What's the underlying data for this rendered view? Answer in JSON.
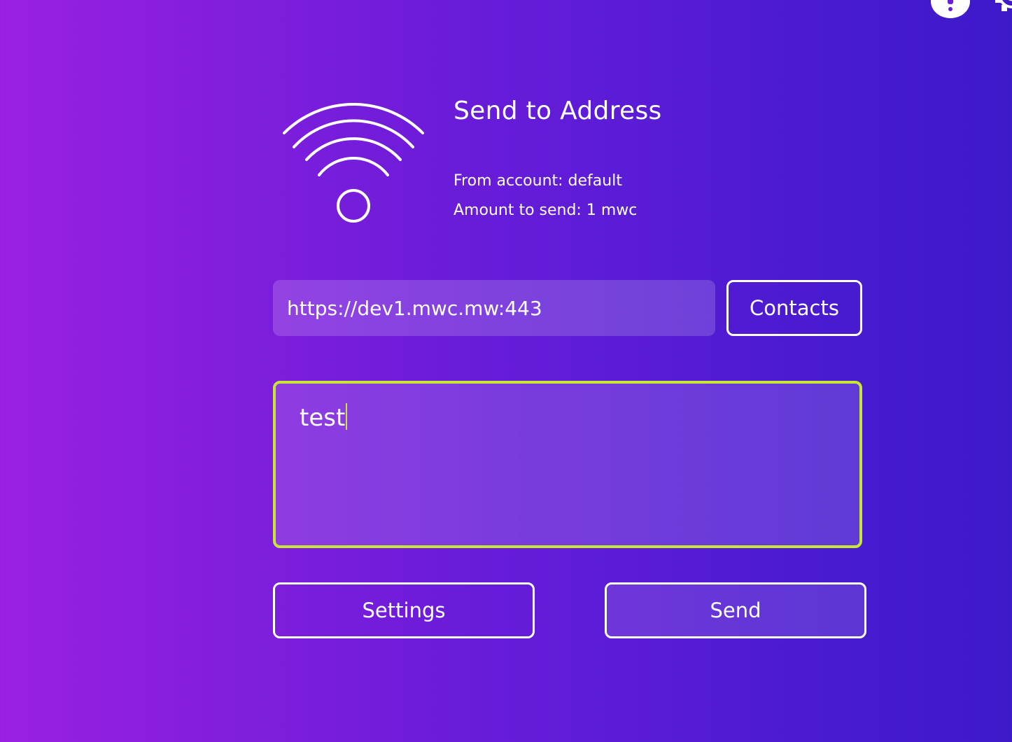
{
  "header": {
    "icons": [
      "info-icon",
      "gear-icon"
    ]
  },
  "page": {
    "title": "Send to Address",
    "from_account": "From account: default",
    "amount": "Amount to send: 1 mwc",
    "icon": "wifi-icon"
  },
  "address": {
    "value": "https://dev1.mwc.mw:443",
    "contacts_label": "Contacts"
  },
  "message": {
    "value": "test"
  },
  "actions": {
    "settings_label": "Settings",
    "send_label": "Send"
  },
  "colors": {
    "background_start": "#9a20e2",
    "background_end": "#3d1ac9",
    "focus_border": "#c8e635",
    "text": "#ffffff"
  }
}
